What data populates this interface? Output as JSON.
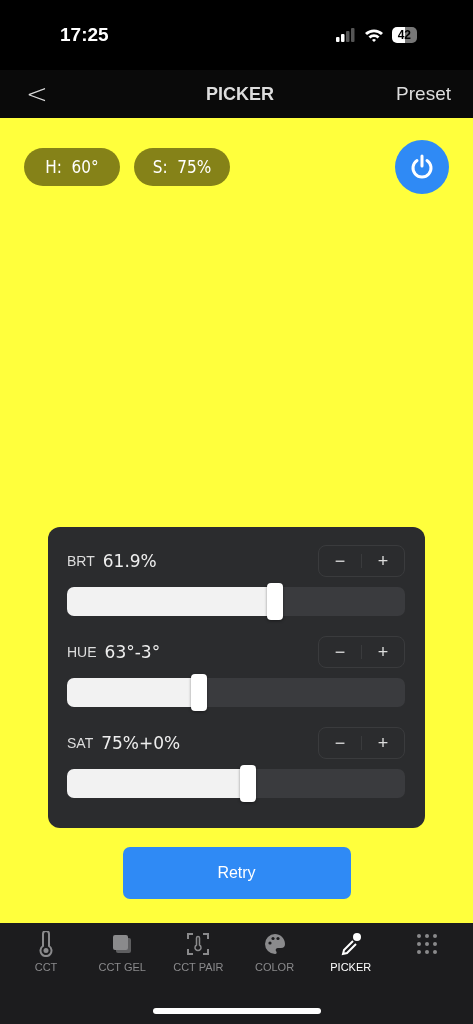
{
  "status_bar": {
    "time": "17:25",
    "battery": "42"
  },
  "nav": {
    "back": "<",
    "title": "PICKER",
    "action": "Preset"
  },
  "chips": [
    {
      "text": "H:  60°"
    },
    {
      "text": "S:  75%"
    }
  ],
  "power": {
    "on": true
  },
  "sliders": [
    {
      "label": "BRT",
      "reading": "61.9%",
      "level": 0.615,
      "minus": "−",
      "plus": "+"
    },
    {
      "label": "HUE",
      "reading": "63°-3°",
      "level": 0.39,
      "minus": "−",
      "plus": "+"
    },
    {
      "label": "SAT",
      "reading": "75%+0%",
      "level": 0.535,
      "minus": "−",
      "plus": "+"
    }
  ],
  "retry": "Retry",
  "tabs": [
    {
      "kind": "thermometer",
      "label": "CCT",
      "selected": false
    },
    {
      "kind": "gel",
      "label": "CCT GEL",
      "selected": false
    },
    {
      "kind": "pair",
      "label": "CCT PAIR",
      "selected": false
    },
    {
      "kind": "palette",
      "label": "COLOR",
      "selected": false
    },
    {
      "kind": "dropper",
      "label": "PICKER",
      "selected": true
    },
    {
      "kind": "more",
      "selected": false
    }
  ]
}
